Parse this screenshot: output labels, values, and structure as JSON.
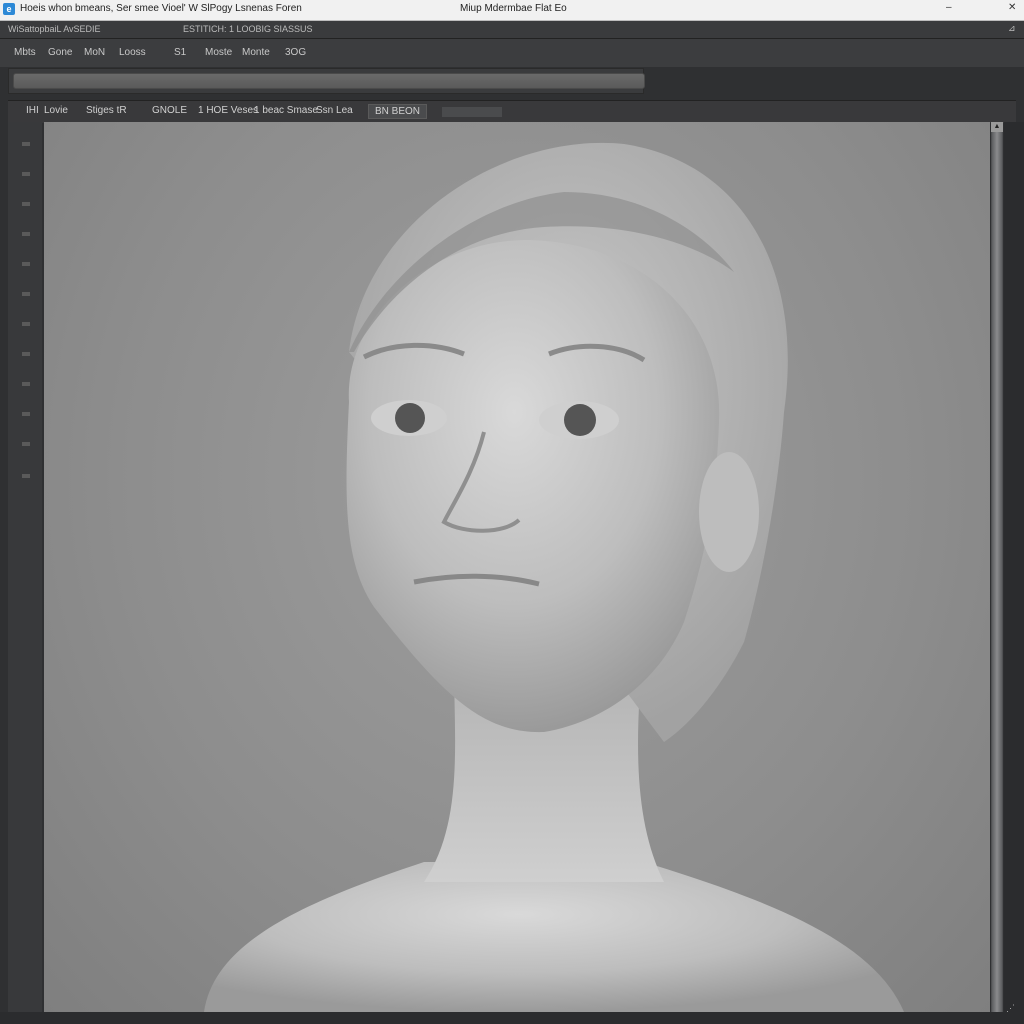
{
  "titlebar": {
    "left_text": "Hoeis whon bmeans, Ser smee Vioel' W SlPogy Lsnenas Foren",
    "center_text": "Miup Mdermbae Flat Eo"
  },
  "infobar": {
    "left_text": "WiSattopbaiL AvSEDIE",
    "center_text": "ESTITICH: 1 LOOBIG SIASSUS"
  },
  "menu": {
    "items": [
      {
        "label": "Mbts"
      },
      {
        "label": "Gone"
      },
      {
        "label": "MoN"
      },
      {
        "label": "Looss"
      },
      {
        "label": "S1"
      },
      {
        "label": "Moste"
      },
      {
        "label": "Monte"
      },
      {
        "label": "3OG"
      }
    ]
  },
  "search": {
    "value": ""
  },
  "tabs": {
    "items": [
      {
        "label": "IHI"
      },
      {
        "label": "Lovie"
      },
      {
        "label": "Stiges tR"
      },
      {
        "label": "GNOLE"
      },
      {
        "label": "1 HOE Veses"
      },
      {
        "label": "1 beac Smase"
      },
      {
        "label": "Ssn Lea"
      },
      {
        "label": "BN BEON"
      }
    ]
  },
  "colors": {
    "accent": "#2d89d6",
    "chrome_dark": "#2f3032",
    "viewport_gray": "#8d8d8d"
  }
}
